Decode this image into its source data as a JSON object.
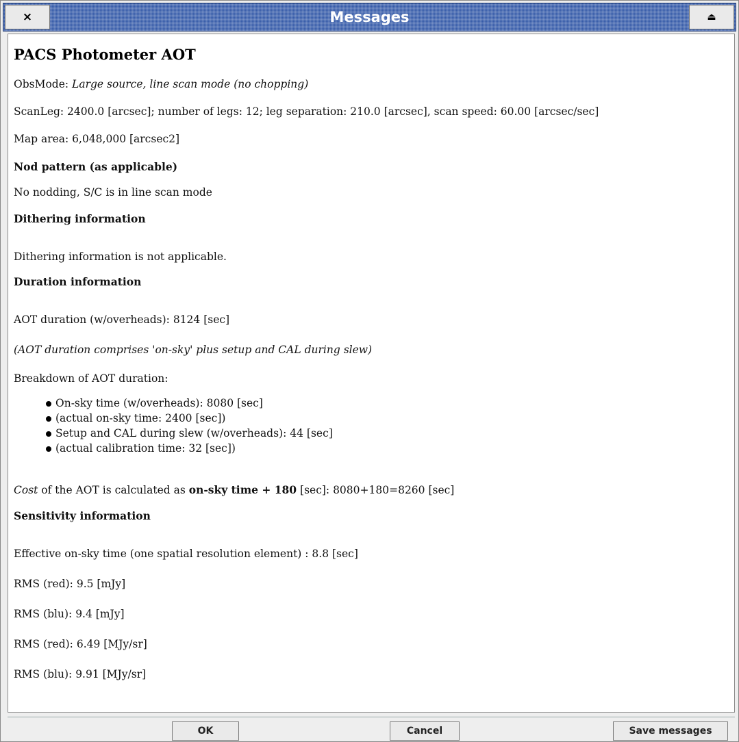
{
  "window": {
    "title": "Messages",
    "close_glyph": "×",
    "eject_glyph": "⏏"
  },
  "content": {
    "heading": "PACS Photometer AOT",
    "obsmode_label": "ObsMode: ",
    "obsmode_value": "Large source, line scan mode (no chopping)",
    "scanleg": "ScanLeg: 2400.0 [arcsec]; number of legs: 12; leg separation: 210.0 [arcsec], scan speed: 60.00 [arcsec/sec]",
    "map_area": "Map area: 6,048,000 [arcsec2]",
    "nod_heading": "Nod pattern (as applicable)",
    "nod_text": "No nodding, S/C is in line scan mode",
    "dither_heading": "Dithering information",
    "dither_text": "Dithering information is not applicable.",
    "duration_heading": "Duration information",
    "aot_duration": "AOT duration (w/overheads): 8124 [sec]",
    "aot_note": "(AOT duration comprises 'on-sky' plus setup and CAL during slew)",
    "breakdown_label": "Breakdown of AOT duration:",
    "breakdown_items": [
      "On-sky time (w/overheads): 8080 [sec]",
      "(actual on-sky time: 2400 [sec])",
      "Setup and CAL during slew (w/overheads): 44 [sec]",
      "(actual calibration time: 32 [sec])"
    ],
    "cost_word": "Cost",
    "cost_mid": " of the AOT is calculated as ",
    "cost_bold": "on-sky time + 180",
    "cost_tail": " [sec]: 8080+180=8260 [sec]",
    "sens_heading": "Sensitivity information",
    "effective_time": "Effective on-sky time (one spatial resolution element) : 8.8 [sec]",
    "rms": [
      "RMS (red): 9.5 [mJy]",
      "RMS (blu): 9.4 [mJy]",
      "RMS (red): 6.49 [MJy/sr]",
      "RMS (blu): 9.91 [MJy/sr]"
    ]
  },
  "buttons": {
    "ok": "OK",
    "cancel": "Cancel",
    "save": "Save messages"
  }
}
